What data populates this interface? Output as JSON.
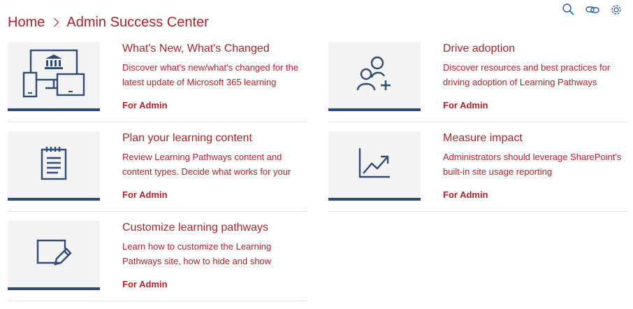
{
  "breadcrumb": {
    "home": "Home",
    "separator_icon": "chevron-right-icon",
    "current": "Admin Success Center"
  },
  "toolbar": {
    "icons": [
      "search-icon",
      "link-icon",
      "gear-icon"
    ]
  },
  "colors": {
    "accent": "#a4262c",
    "icon": "#2f4b72",
    "thumb_bg": "#f3f3f3",
    "divider": "#e1e1e1"
  },
  "cards": [
    {
      "title": "What's New, What's Changed",
      "description": "Discover what's new/what's changed for the latest update of Microsoft 365 learning",
      "tag": "For Admin",
      "icon": "devices-icon"
    },
    {
      "title": "Drive adoption",
      "description": "Discover resources and best practices for driving adoption of Learning Pathways",
      "tag": "For Admin",
      "icon": "people-add-icon"
    },
    {
      "title": "Plan your learning content",
      "description": "Review Learning Pathways content and content types. Decide what works for your",
      "tag": "For Admin",
      "icon": "notepad-icon"
    },
    {
      "title": "Measure impact",
      "description": "Administrators should leverage SharePoint's built-in site usage reporting",
      "tag": "For Admin",
      "icon": "chart-icon"
    },
    {
      "title": "Customize learning pathways",
      "description": "Learn how to customize the Learning Pathways site, how to hide and show",
      "tag": "For Admin",
      "icon": "edit-icon"
    }
  ]
}
